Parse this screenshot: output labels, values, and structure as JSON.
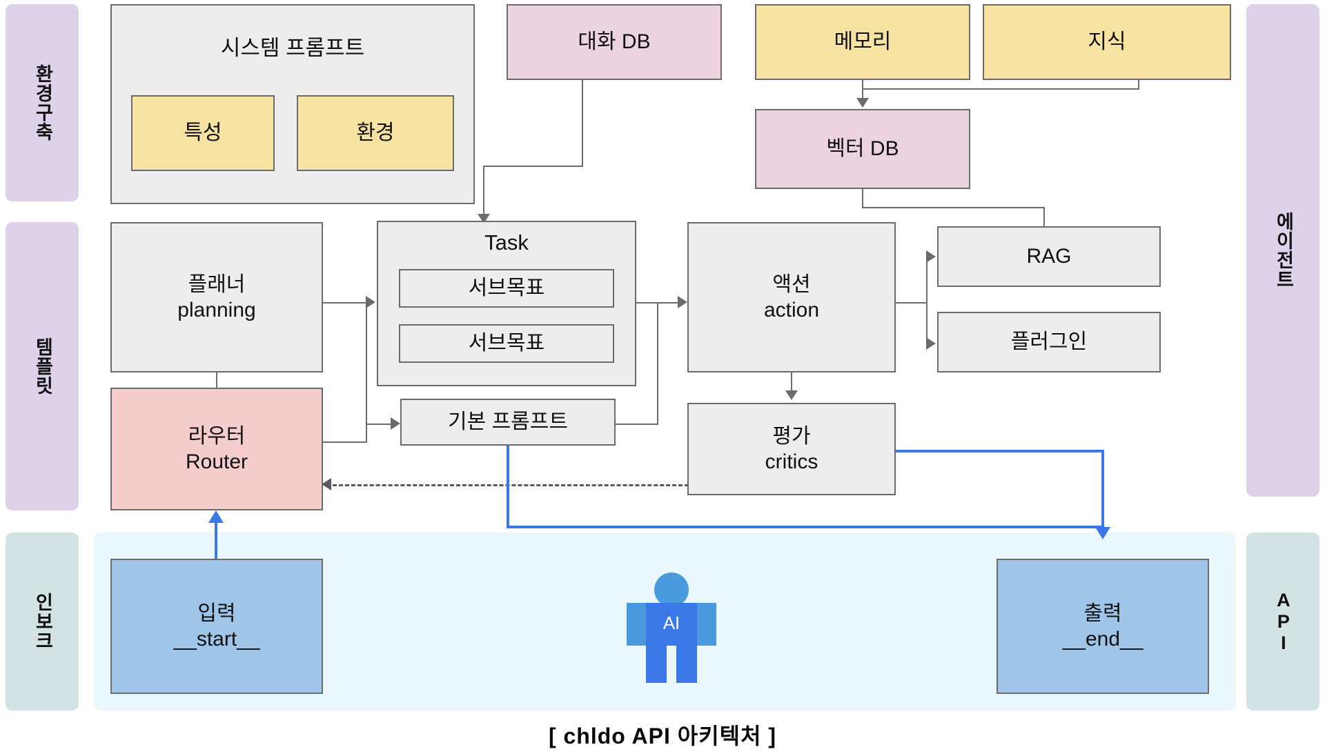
{
  "caption": "[ chldo API 아키텍처 ]",
  "left_rails": [
    {
      "id": "env-build",
      "label": "환경구축"
    },
    {
      "id": "template",
      "label": "템플릿"
    },
    {
      "id": "inbox",
      "label": "인보크"
    }
  ],
  "right_rails": [
    {
      "id": "agent",
      "label": "에이전트"
    },
    {
      "id": "api",
      "label": "API"
    }
  ],
  "groups": {
    "system_prompt": {
      "title": "시스템 프롬프트",
      "children": [
        {
          "id": "trait",
          "label": "특성"
        },
        {
          "id": "environment",
          "label": "환경"
        }
      ]
    },
    "task": {
      "title": "Task",
      "children": [
        {
          "id": "subgoal-1",
          "label": "서브목표"
        },
        {
          "id": "subgoal-2",
          "label": "서브목표"
        }
      ]
    }
  },
  "nodes": {
    "chat_db": "대화 DB",
    "memory": "메모리",
    "knowledge": "지식",
    "vector_db": "벡터 DB",
    "planner": "플래너\nplanning",
    "router": "라우터\nRouter",
    "base_prompt": "기본 프롬프트",
    "action": "액션\naction",
    "rag": "RAG",
    "plugin": "플러그인",
    "critics": "평가\ncritics",
    "start": "입력\n__start__",
    "end": "출력\n__end__"
  },
  "ai_figure": {
    "label": "AI"
  },
  "colors": {
    "yellow": "#f7e3a1",
    "pink": "#ecd3e0",
    "gray": "#ededed",
    "red": "#f5cdcd",
    "blue": "#9fc5e8",
    "rail_purple": "#ddd2ea",
    "rail_teal": "#d3e2e2",
    "band": "#eaf7fd",
    "accent_blue": "#3b78e7",
    "stroke": "#6b6b6b"
  }
}
